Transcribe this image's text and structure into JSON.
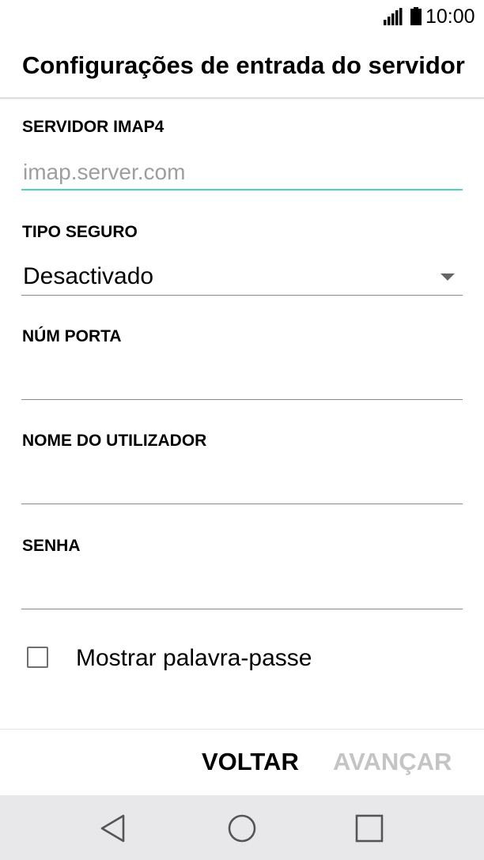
{
  "status_bar": {
    "time": "10:00",
    "icons": [
      "signal-icon",
      "battery-icon"
    ]
  },
  "header": {
    "title": "Configurações de entrada do servidor"
  },
  "form": {
    "imap_server": {
      "label": "SERVIDOR IMAP4",
      "value": "",
      "placeholder": "imap.server.com"
    },
    "security_type": {
      "label": "TIPO SEGURO",
      "selected": "Desactivado"
    },
    "port": {
      "label": "NÚM PORTA",
      "value": ""
    },
    "username": {
      "label": "NOME DO UTILIZADOR",
      "value": ""
    },
    "password": {
      "label": "SENHA",
      "value": ""
    },
    "show_password": {
      "label": "Mostrar palavra-passe",
      "checked": false
    }
  },
  "buttons": {
    "back": "VOLTAR",
    "next": "AVANÇAR"
  },
  "colors": {
    "focus_accent": "#4fd1bd",
    "disabled_text": "#c4c4c4",
    "nav_bar_bg": "#e8e8ea"
  },
  "nav_bar": {
    "icons": [
      "nav-back-icon",
      "nav-home-icon",
      "nav-recents-icon"
    ]
  }
}
